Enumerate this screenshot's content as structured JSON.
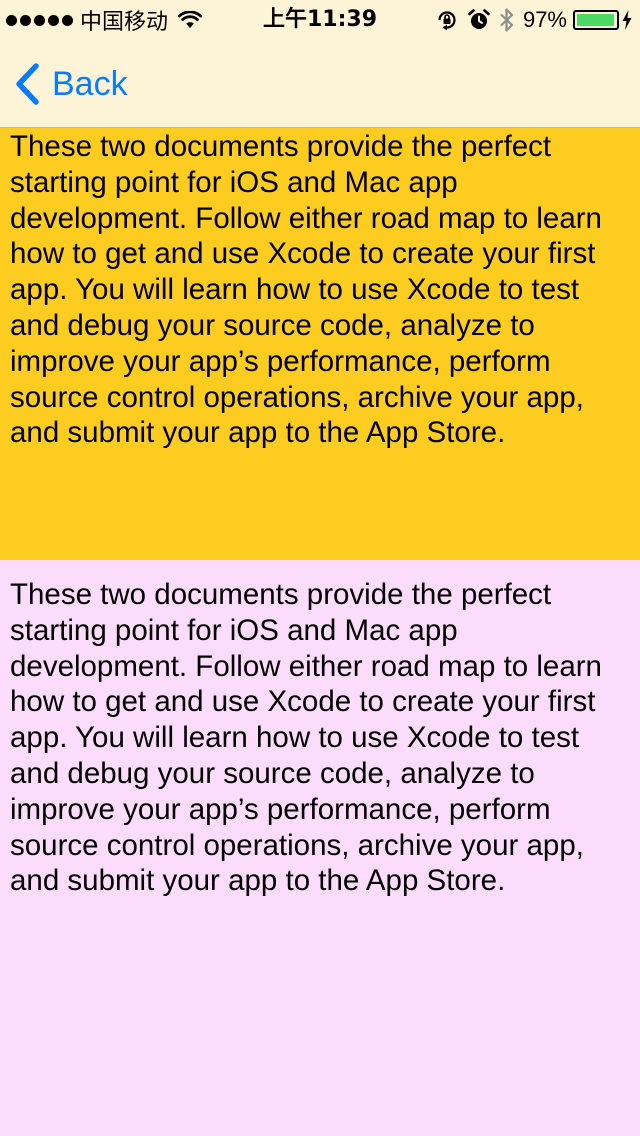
{
  "status_bar": {
    "carrier": "中国移动",
    "time": "上午11:39",
    "battery_percent": "97%",
    "battery_level": 0.97,
    "battery_color": "#4cd964",
    "icons": [
      "signal-dots-icon",
      "wifi-icon",
      "rotation-lock-icon",
      "alarm-icon",
      "bluetooth-icon",
      "battery-icon",
      "charging-icon"
    ]
  },
  "nav": {
    "back_label": "Back",
    "back_icon": "chevron-left-icon",
    "tint_color": "#0a7aff"
  },
  "panels": [
    {
      "background": "#fdcc21",
      "text": "These two documents provide the perfect starting point for iOS and Mac app development. Follow either road map to learn how to get and use Xcode to create your first app. You will learn how to use Xcode to test and debug your source code, analyze to improve your app’s performance, perform source control operations, archive your app, and submit your app to the App Store."
    },
    {
      "background": "#fcdcfb",
      "text": "These two documents provide the perfect starting point for iOS and Mac app development. Follow either road map to learn how to get and use Xcode to create your first app. You will learn how to use Xcode to test and debug your source code, analyze to improve your app’s performance, perform source control operations, archive your app, and submit your app to the App Store."
    }
  ]
}
